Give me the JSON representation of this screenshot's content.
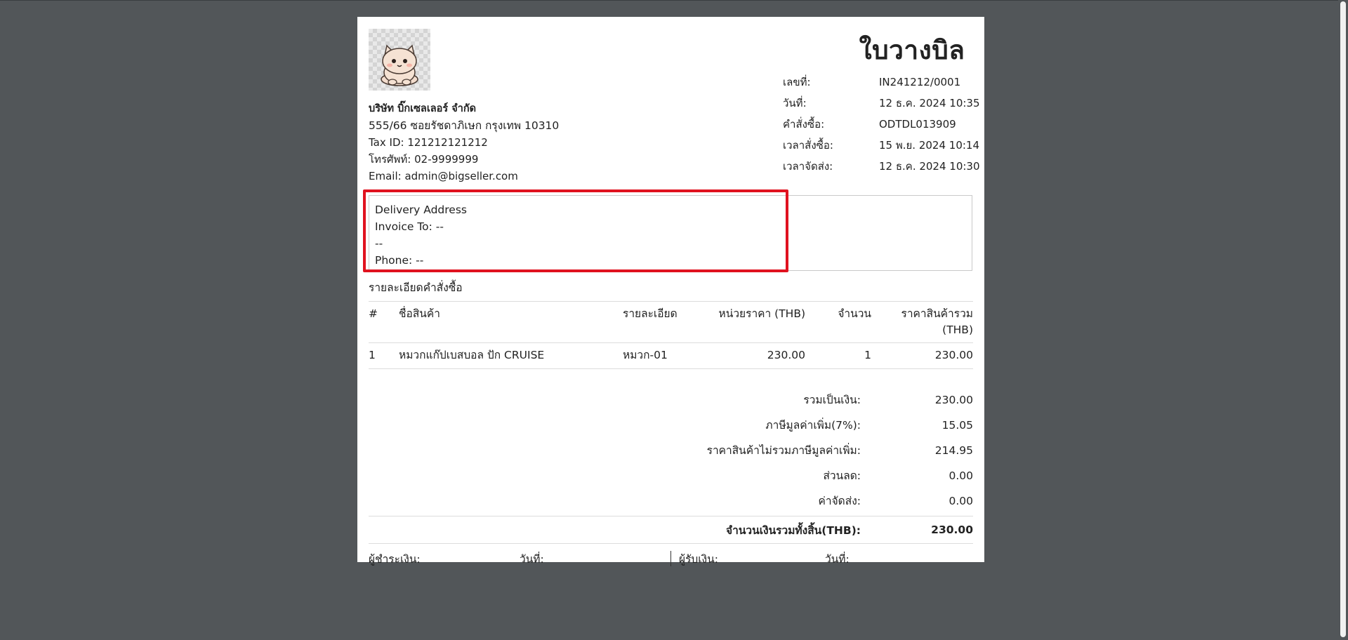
{
  "company": {
    "name": "บริษัท บิ๊กเซลเลอร์ จำกัด",
    "address": "555/66 ซอยรัชดาภิเษก กรุงเทพ 10310",
    "tax_id": "Tax ID: 121212121212",
    "phone": "โทรศัพท์: 02-9999999",
    "email": "Email: admin@bigseller.com",
    "logo_icon": "cat-logo-icon"
  },
  "doc": {
    "title": "ใบวางบิล",
    "meta": [
      {
        "label": "เลขที่:",
        "value": "IN241212/0001"
      },
      {
        "label": "วันที่:",
        "value": "12 ธ.ค. 2024 10:35"
      },
      {
        "label": "คำสั่งซื้อ:",
        "value": "ODTDL013909"
      },
      {
        "label": "เวลาสั่งซื้อ:",
        "value": "15 พ.ย. 2024 10:14"
      },
      {
        "label": "เวลาจัดส่ง:",
        "value": "12 ธ.ค. 2024 10:30"
      }
    ]
  },
  "delivery": {
    "heading": "Delivery Address",
    "invoice_to": "Invoice To: --",
    "address": "--",
    "phone": "Phone: --",
    "highlight_color": "#e0121f"
  },
  "order": {
    "section_title": "รายละเอียดคำสั่งซื้อ",
    "columns": [
      "#",
      "ชื่อสินค้า",
      "รายละเอียด",
      "หน่วยราคา (THB)",
      "จำนวน",
      "ราคาสินค้ารวม (THB)"
    ],
    "rows": [
      [
        "1",
        "หมวกแก๊ปเบสบอล ปัก CRUISE",
        "หมวก-01",
        "230.00",
        "1",
        "230.00"
      ]
    ]
  },
  "totals": [
    {
      "label": "รวมเป็นเงิน:",
      "value": "230.00"
    },
    {
      "label": "ภาษีมูลค่าเพิ่ม(7%):",
      "value": "15.05"
    },
    {
      "label": "ราคาสินค้าไม่รวมภาษีมูลค่าเพิ่ม:",
      "value": "214.95"
    },
    {
      "label": "ส่วนลด:",
      "value": "0.00"
    },
    {
      "label": "ค่าจัดส่ง:",
      "value": "0.00"
    }
  ],
  "grand_total": {
    "label": "จำนวนเงินรวมทั้งสิ้น(THB):",
    "value": "230.00"
  },
  "signatures": {
    "payer": "ผู้ชำระเงิน:",
    "payer_date": "วันที่:",
    "receiver": "ผู้รับเงิน:",
    "receiver_date": "วันที่:"
  }
}
